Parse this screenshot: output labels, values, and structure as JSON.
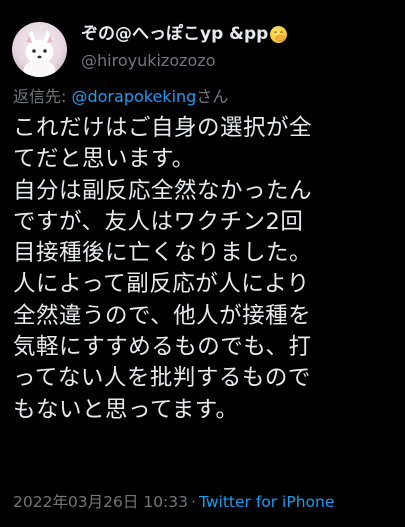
{
  "tweet": {
    "author": {
      "display_name": "ぞの@へっぽこyp &pp",
      "emoji": "face-with-hand-over-mouth",
      "handle": "@hiroyukizozozo"
    },
    "reply": {
      "prefix": "返信先: ",
      "mention": "@dorapokeking",
      "suffix": "さん"
    },
    "text_lines": [
      "これだけはご自身の選択が全",
      "てだと思います。",
      "自分は副反応全然なかったん",
      "ですが、友人はワクチン2回",
      "目接種後に亡くなりました。",
      "人によって副反応が人により",
      "全然違うので、他人が接種を",
      "気軽にすすめるものでも、打",
      "ってない人を批判するもので",
      "もないと思ってます。"
    ],
    "timestamp": "2022年03月26日 10:33",
    "separator": "·",
    "source": "Twitter for iPhone"
  },
  "colors": {
    "background": "#000000",
    "text": "#e7e9ea",
    "secondary": "#71767b",
    "link": "#1d9bf0"
  }
}
